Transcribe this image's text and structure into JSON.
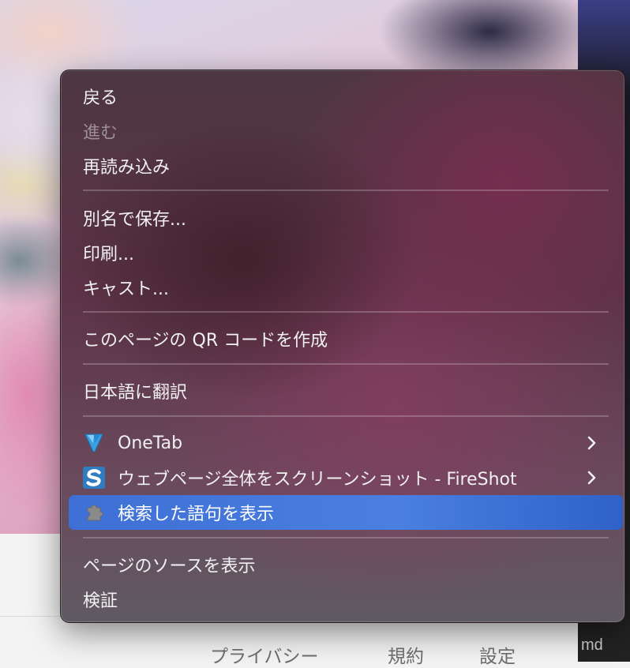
{
  "background": {
    "shortcut_fragment": "md",
    "footer_links": [
      "プライバシー",
      "規約",
      "設定"
    ]
  },
  "menu": {
    "sections": [
      {
        "items": [
          {
            "label": "戻る",
            "enabled": true
          },
          {
            "label": "進む",
            "enabled": false
          },
          {
            "label": "再読み込み",
            "enabled": true
          }
        ]
      },
      {
        "items": [
          {
            "label": "別名で保存..."
          },
          {
            "label": "印刷..."
          },
          {
            "label": "キャスト..."
          }
        ]
      },
      {
        "items": [
          {
            "label": "このページの QR コードを作成"
          }
        ]
      },
      {
        "items": [
          {
            "label": "日本語に翻訳"
          }
        ]
      },
      {
        "items": [
          {
            "label": "OneTab",
            "icon": "onetab-funnel-icon",
            "has_submenu": true
          },
          {
            "label": "ウェブページ全体をスクリーンショット - FireShot",
            "icon": "fireshot-icon",
            "has_submenu": true
          },
          {
            "label": "検索した語句を表示",
            "icon": "extension-puzzle-icon",
            "highlighted": true
          }
        ]
      },
      {
        "items": [
          {
            "label": "ページのソースを表示"
          },
          {
            "label": "検証"
          }
        ]
      }
    ]
  },
  "colors": {
    "highlight": "#4a7fe0",
    "menu_text": "#f1f1f1",
    "disabled_text": "#9b8e96"
  }
}
